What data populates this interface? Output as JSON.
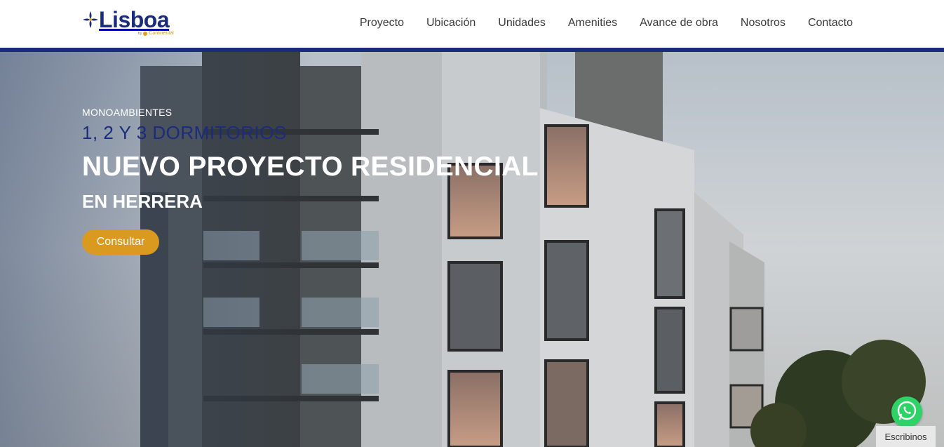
{
  "brand": {
    "name": "Lisboa",
    "by": "by",
    "developer": "Continental",
    "colors": {
      "primary": "#1b2b7e",
      "accent": "#d99a1f"
    }
  },
  "nav": {
    "items": [
      {
        "label": "Proyecto"
      },
      {
        "label": "Ubicación"
      },
      {
        "label": "Unidades"
      },
      {
        "label": "Amenities"
      },
      {
        "label": "Avance de obra"
      },
      {
        "label": "Nosotros"
      },
      {
        "label": "Contacto"
      }
    ]
  },
  "hero": {
    "eyebrow": "MONOAMBIENTES",
    "subtitle": "1, 2 Y 3 DORMITORIOS",
    "title": "NUEVO PROYECTO RESIDENCIAL",
    "location": "EN HERRERA",
    "cta_label": "Consultar"
  },
  "whatsapp": {
    "icon": "whatsapp-icon",
    "label": "Escribinos"
  }
}
